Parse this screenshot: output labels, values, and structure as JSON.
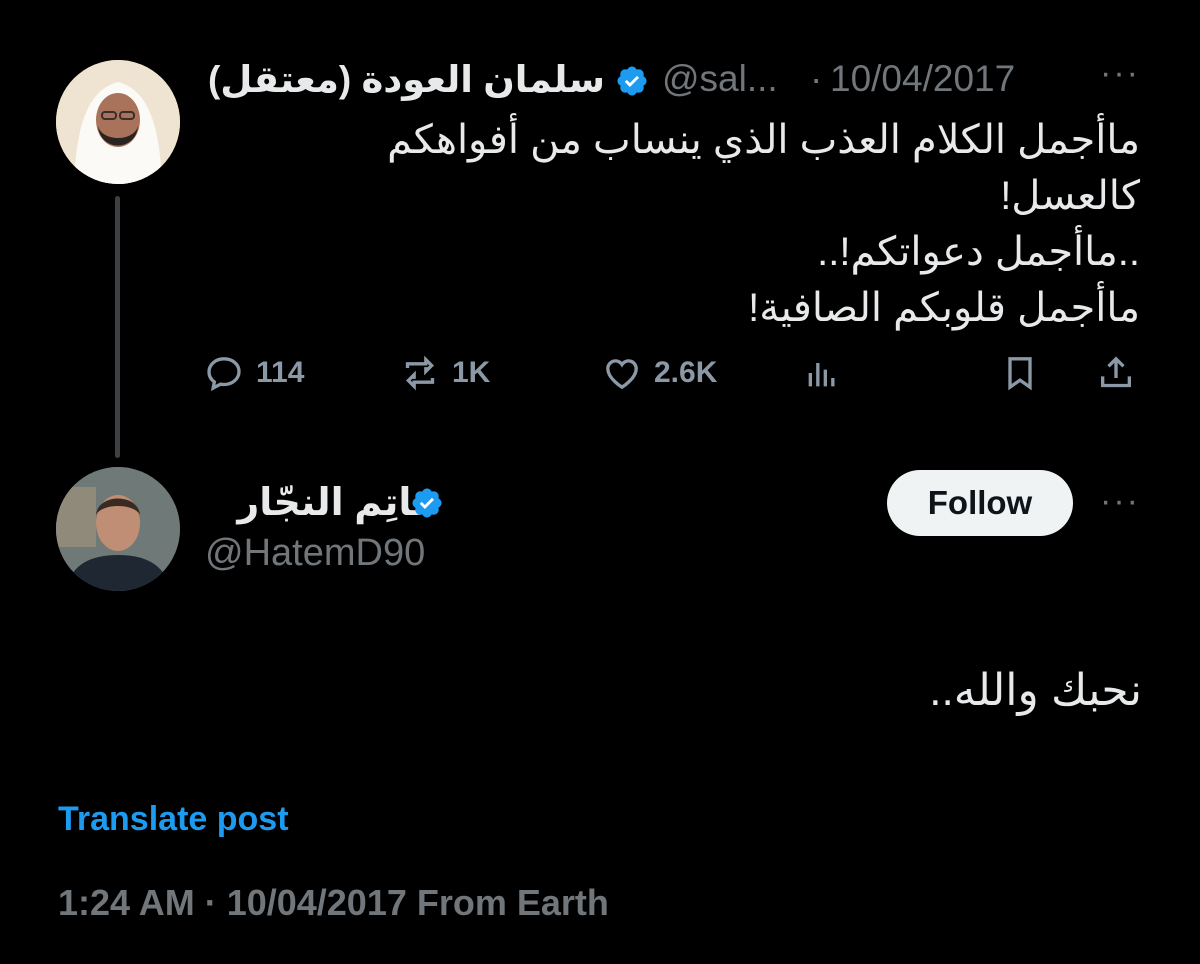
{
  "original": {
    "name": "سلمان العودة (معتقل)",
    "handle": "@sal...",
    "separator": "·",
    "date": "10/04/2017",
    "more": "···",
    "text_lines": [
      "ماأجمل الكلام العذب الذي ينساب من أفواهكم",
      "كالعسل!",
      "..ماأجمل دعواتكم!..",
      "ماأجمل قلوبكم الصافية!"
    ],
    "replies": "114",
    "retweets": "1K",
    "likes": "2.6K"
  },
  "reply": {
    "name": "حاتِم النجّار",
    "handle": "@HatemD90",
    "follow_label": "Follow",
    "more": "···",
    "text": "نحبك والله..",
    "translate_label": "Translate post",
    "meta": "1:24 AM · 10/04/2017 From Earth"
  },
  "colors": {
    "background": "#000000",
    "text": "#e7e9ea",
    "muted": "#71767b",
    "accent": "#1d9bf0",
    "follow_bg": "#eff3f4"
  },
  "icons": [
    "reply-icon",
    "retweet-icon",
    "like-icon",
    "views-icon",
    "bookmark-icon",
    "share-icon",
    "verified-icon"
  ]
}
